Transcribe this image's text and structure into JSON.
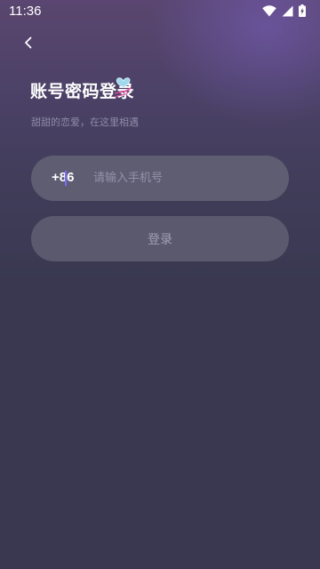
{
  "status_bar": {
    "time": "11:36",
    "icons": [
      "wifi-icon",
      "cell-signal-icon",
      "battery-icon"
    ]
  },
  "nav": {
    "back_icon": "chevron-left-icon"
  },
  "header": {
    "title": "账号密码登录",
    "subtitle": "甜甜的恋爱，在这里相遇",
    "decoration_icon": "heart-icon"
  },
  "form": {
    "country_code": "+86",
    "phone_value": "",
    "phone_placeholder": "请输入手机号",
    "login_label": "登录"
  },
  "colors": {
    "background": "#393850",
    "gradient_top": "#5a4670",
    "input_bg": "#5e5d72",
    "button_bg": "#5a596e",
    "caret": "#7b6cff",
    "button_text": "#a19fb3",
    "placeholder": "#9592a8"
  }
}
